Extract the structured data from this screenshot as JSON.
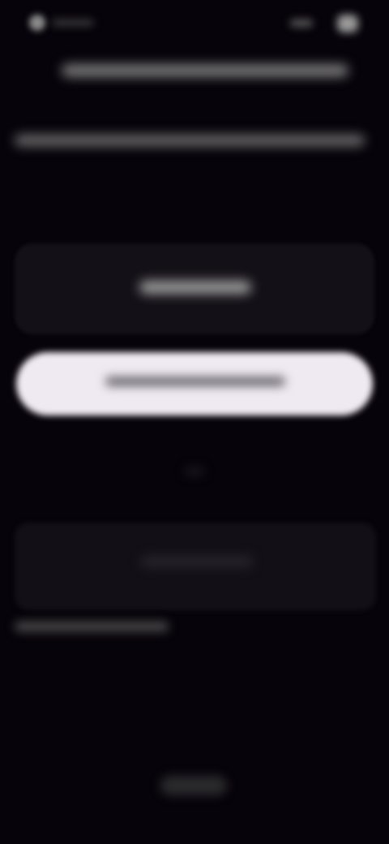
{
  "status_bar": {
    "left_icon": "avatar-icon",
    "right_icon": "battery-icon"
  },
  "header": {
    "title": ""
  },
  "description": {
    "text": ""
  },
  "info_card": {
    "label": ""
  },
  "primary_button": {
    "label": "",
    "background_color": "#efeaf1"
  },
  "secondary_card": {
    "label": ""
  },
  "footnote": {
    "text": ""
  },
  "bottom_button": {
    "label": ""
  },
  "colors": {
    "background": "#07030a",
    "card": "#141017",
    "primary_button": "#efeaf1"
  }
}
